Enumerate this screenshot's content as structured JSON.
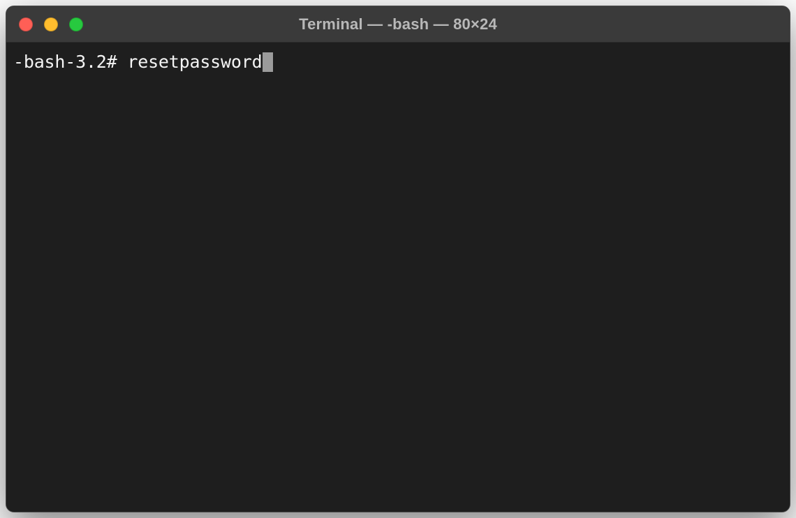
{
  "window": {
    "title": "Terminal — -bash — 80×24"
  },
  "terminal": {
    "prompt": "-bash-3.2# ",
    "command": "resetpassword"
  },
  "colors": {
    "close": "#ff5f56",
    "minimize": "#ffbd2e",
    "zoom": "#27c93f",
    "bg": "#1e1e1e",
    "titlebar": "#3a3a3a"
  }
}
